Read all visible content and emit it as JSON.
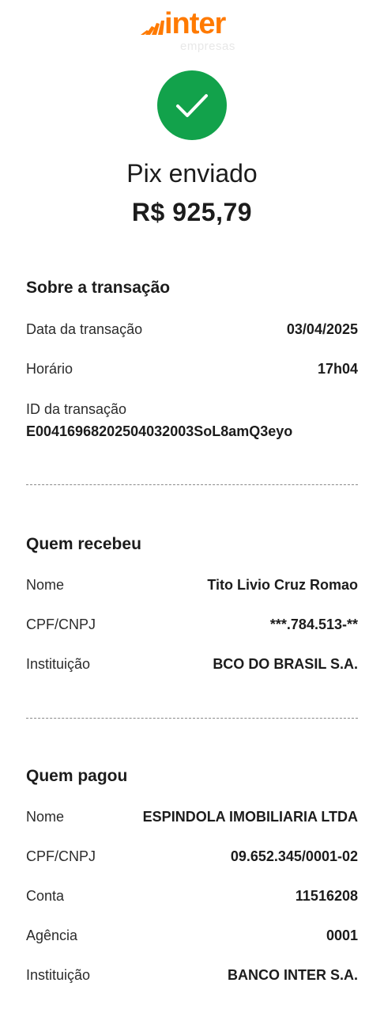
{
  "brand": {
    "name": "inter",
    "sub": "empresas",
    "color": "#ff7a00"
  },
  "status": {
    "icon": "checkmark-icon",
    "color": "#12a24b",
    "title": "Pix enviado",
    "amount": "R$ 925,79"
  },
  "transaction": {
    "title": "Sobre a transação",
    "date_label": "Data da transação",
    "date_value": "03/04/2025",
    "time_label": "Horário",
    "time_value": "17h04",
    "id_label": "ID da transação",
    "id_value": "E00416968202504032003SoL8amQ3eyo"
  },
  "receiver": {
    "title": "Quem recebeu",
    "name_label": "Nome",
    "name_value": "Tito Livio Cruz Romao",
    "doc_label": "CPF/CNPJ",
    "doc_value": "***.784.513-**",
    "inst_label": "Instituição",
    "inst_value": "BCO DO BRASIL S.A."
  },
  "payer": {
    "title": "Quem pagou",
    "name_label": "Nome",
    "name_value": "ESPINDOLA IMOBILIARIA LTDA",
    "doc_label": "CPF/CNPJ",
    "doc_value": "09.652.345/0001-02",
    "account_label": "Conta",
    "account_value": "11516208",
    "agency_label": "Agência",
    "agency_value": "0001",
    "inst_label": "Instituição",
    "inst_value": "BANCO INTER S.A."
  }
}
